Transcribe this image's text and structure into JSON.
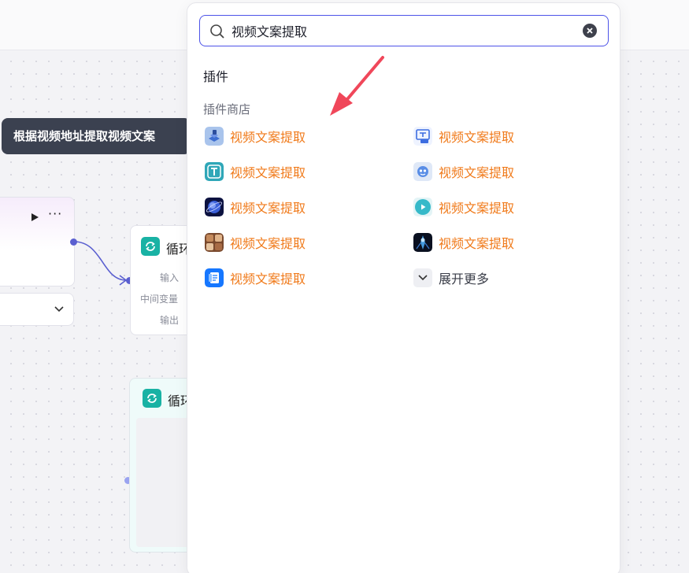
{
  "tooltip": {
    "text": "根据视频地址提取视频文案"
  },
  "canvas": {
    "loop_node": {
      "title": "循环",
      "ports": [
        "输入",
        "中间变量",
        "输出"
      ]
    },
    "loop_node_2": {
      "title": "循环"
    }
  },
  "search": {
    "value": "视频文案提取",
    "placeholder": ""
  },
  "panel": {
    "section_title": "插件",
    "subsection_title": "插件商店",
    "plugins": [
      {
        "label": "视频文案提取",
        "icon": "book-stack-icon"
      },
      {
        "label": "视频文案提取",
        "icon": "screen-text-icon"
      },
      {
        "label": "视频文案提取",
        "icon": "text-t-icon"
      },
      {
        "label": "视频文案提取",
        "icon": "robot-icon"
      },
      {
        "label": "视频文案提取",
        "icon": "planet-icon"
      },
      {
        "label": "视频文案提取",
        "icon": "play-circle-icon"
      },
      {
        "label": "视频文案提取",
        "icon": "photo-grid-icon"
      },
      {
        "label": "视频文案提取",
        "icon": "ai-figure-icon"
      },
      {
        "label": "视频文案提取",
        "icon": "document-blue-icon"
      }
    ],
    "expand_more": "展开更多"
  },
  "colors": {
    "accent": "#4d53e8",
    "plugin_label": "#f07a1a",
    "loop_icon": "#19b2a4",
    "annotation_arrow": "#f0475a"
  }
}
